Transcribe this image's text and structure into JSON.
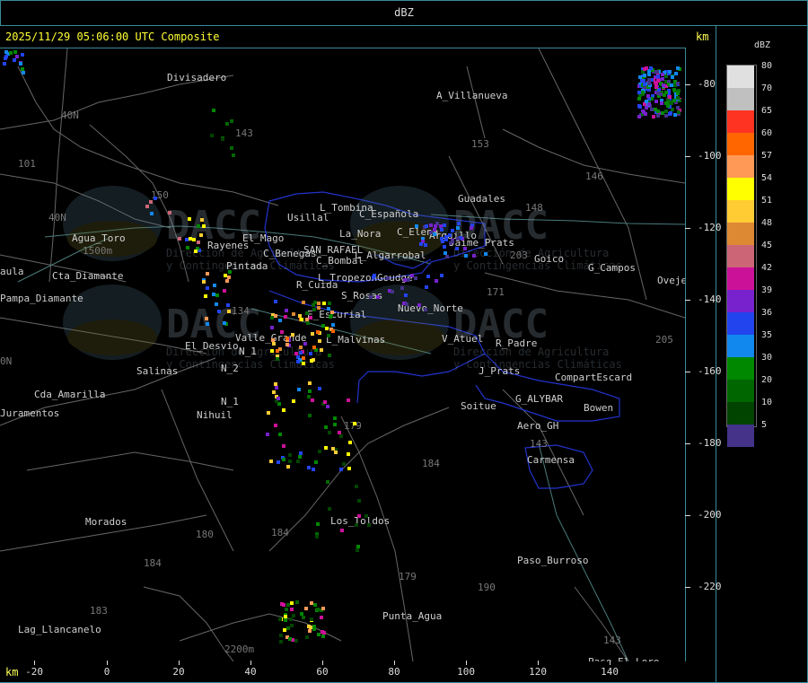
{
  "title_bar": "dBZ",
  "header": "2025/11/29 05:06:00 UTC Composite",
  "km_label_top": "km",
  "km_label_bottom": "km",
  "y_ticks": [
    "-80",
    "-100",
    "-120",
    "-140",
    "-160",
    "-180",
    "-200",
    "-220"
  ],
  "x_ticks": [
    "-20",
    "0",
    "20",
    "40",
    "60",
    "80",
    "100",
    "120",
    "140"
  ],
  "legend": {
    "title": "dBZ",
    "levels": [
      {
        "value": "80",
        "color": "#e0e0e0"
      },
      {
        "value": "70",
        "color": "#c0c0c0"
      },
      {
        "value": "65",
        "color": "#ff3322"
      },
      {
        "value": "60",
        "color": "#ff6600"
      },
      {
        "value": "57",
        "color": "#ff9955"
      },
      {
        "value": "54",
        "color": "#ffff00"
      },
      {
        "value": "51",
        "color": "#ffcc33"
      },
      {
        "value": "48",
        "color": "#dd8833"
      },
      {
        "value": "45",
        "color": "#cc6677"
      },
      {
        "value": "42",
        "color": "#cc1199"
      },
      {
        "value": "39",
        "color": "#7722cc"
      },
      {
        "value": "36",
        "color": "#2244ee"
      },
      {
        "value": "35",
        "color": "#1188ee"
      },
      {
        "value": "30",
        "color": "#008800"
      },
      {
        "value": "20",
        "color": "#006600"
      },
      {
        "value": "10",
        "color": "#004400"
      },
      {
        "value": "5",
        "color": "#443388"
      }
    ]
  },
  "watermark": {
    "brand": "DACC",
    "line1": "Dirección de Agricultura",
    "line2": "y Contingencias Climáticas"
  },
  "places": [
    "Divisadero",
    "A_Villanueva",
    "40N",
    "101",
    "143",
    "153",
    "146",
    "Guadales",
    "150",
    "L_Tombina",
    "Usillal",
    "C_Española",
    "La_Nora",
    "C_Elena",
    "Arquillo",
    "Jaime_Prats",
    "148",
    "Agua_Toro",
    "1500m",
    "40N",
    "203",
    "Goico",
    "G_Campos",
    "Ovejero",
    "Rayenes",
    "El_Mago",
    "C_Benegas",
    "SAN_RAFAEL",
    "L_Algarrobal",
    "Pintada",
    "C_Bombal",
    "Cta_Diamante",
    "Pampa_Diamante",
    "R_Cuida",
    "L_Tropezon",
    "Goudge",
    "S_Rosas",
    "171",
    "Nuevo_Norte",
    "E_Escurial",
    "134",
    "Valle_Grande",
    "L_Malvinas",
    "V_Atuel",
    "R_Padre",
    "205",
    "El_Desvio",
    "N_1",
    "N_2",
    "Salinas",
    "J_Prats",
    "CompartEscard",
    "Cda_Amarilla",
    "N_1",
    "Nihuil",
    "G_ALYBAR",
    "Soitue",
    "Bowen",
    "Aero_GH",
    "Juramentos",
    "179",
    "184",
    "143",
    "Carmensa",
    "Morados",
    "Los_Toldos",
    "180",
    "184",
    "184",
    "179",
    "190",
    "Paso_Burroso",
    "183",
    "Punta_Agua",
    "Lag_Llancanelo",
    "2200m",
    "143",
    "Paso_El_Loro",
    "aula",
    "0N"
  ]
}
